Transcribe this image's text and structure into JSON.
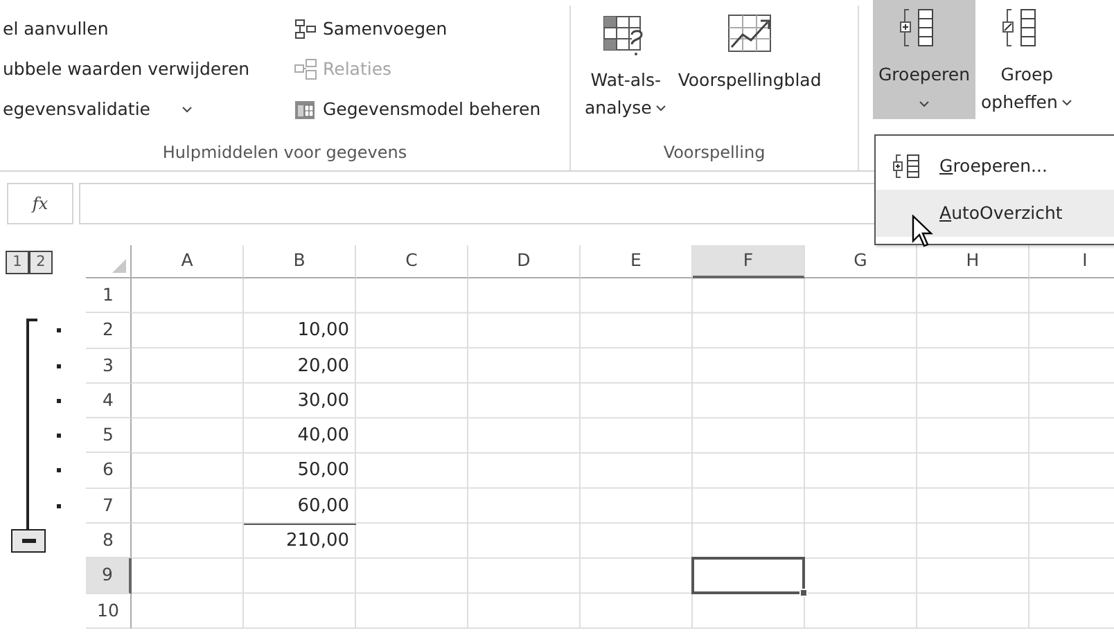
{
  "ribbon": {
    "groups": [
      {
        "kind": "list",
        "label": "Hulpmiddelen voor gegevens",
        "commands": [
          {
            "label": "el aanvullen",
            "disabled": false,
            "dropdown": false
          },
          {
            "label": "ubbele waarden verwijderen",
            "disabled": false,
            "dropdown": false
          },
          {
            "label": "egevensvalidatie",
            "disabled": false,
            "dropdown": true
          },
          {
            "label": "Samenvoegen",
            "disabled": false,
            "dropdown": false
          },
          {
            "label": "Relaties",
            "disabled": true,
            "dropdown": false
          },
          {
            "label": "Gegevensmodel beheren",
            "disabled": false,
            "dropdown": false
          }
        ]
      },
      {
        "kind": "large",
        "label": "Voorspelling",
        "buttons": [
          {
            "lines": [
              "Wat-als-",
              "analyse"
            ],
            "dropdown": true,
            "caret_below": false,
            "selected": false
          },
          {
            "lines": [
              "Voorspellingblad"
            ],
            "dropdown": false,
            "caret_below": false,
            "selected": false
          }
        ]
      },
      {
        "kind": "large",
        "buttons": [
          {
            "lines": [
              "Groeperen"
            ],
            "dropdown": true,
            "caret_below": true,
            "selected": true
          },
          {
            "lines": [
              "Groep",
              "opheffen"
            ],
            "dropdown": true,
            "caret_below": false,
            "selected": false
          }
        ]
      }
    ]
  },
  "menu": {
    "items": [
      {
        "label": "Groeperen...",
        "icon": true,
        "hovered": false
      },
      {
        "label": "AutoOverzicht",
        "icon": false,
        "hovered": true
      }
    ]
  },
  "formula_bar": {
    "fx": "fx"
  },
  "sheet": {
    "outline_levels": [
      "1",
      "2"
    ],
    "columns": [
      {
        "label": "A",
        "selected": false
      },
      {
        "label": "B",
        "selected": false
      },
      {
        "label": "C",
        "selected": false
      },
      {
        "label": "D",
        "selected": false
      },
      {
        "label": "E",
        "selected": false
      },
      {
        "label": "F",
        "selected": true
      },
      {
        "label": "G",
        "selected": false
      },
      {
        "label": "H",
        "selected": false
      },
      {
        "label": "I",
        "selected": false
      }
    ],
    "rows": [
      {
        "kind": "plain",
        "header": "1",
        "cells": [],
        "selected": false
      },
      {
        "kind": "detail",
        "header": "2",
        "cells": [
          null,
          "10,00"
        ],
        "selected": false
      },
      {
        "kind": "detail",
        "header": "3",
        "cells": [
          null,
          "20,00"
        ],
        "selected": false
      },
      {
        "kind": "detail",
        "header": "4",
        "cells": [
          null,
          "30,00"
        ],
        "selected": false
      },
      {
        "kind": "detail",
        "header": "5",
        "cells": [
          null,
          "40,00"
        ],
        "selected": false
      },
      {
        "kind": "detail",
        "header": "6",
        "cells": [
          null,
          "50,00"
        ],
        "selected": false
      },
      {
        "kind": "detail",
        "header": "7",
        "cells": [
          null,
          "60,00"
        ],
        "selected": false
      },
      {
        "kind": "summary",
        "header": "8",
        "cells": [
          null,
          "210,00"
        ],
        "selected": false
      },
      {
        "kind": "plain",
        "header": "9",
        "cells": [],
        "selected": true
      },
      {
        "kind": "plain",
        "header": "10",
        "cells": [],
        "selected": false
      }
    ]
  }
}
